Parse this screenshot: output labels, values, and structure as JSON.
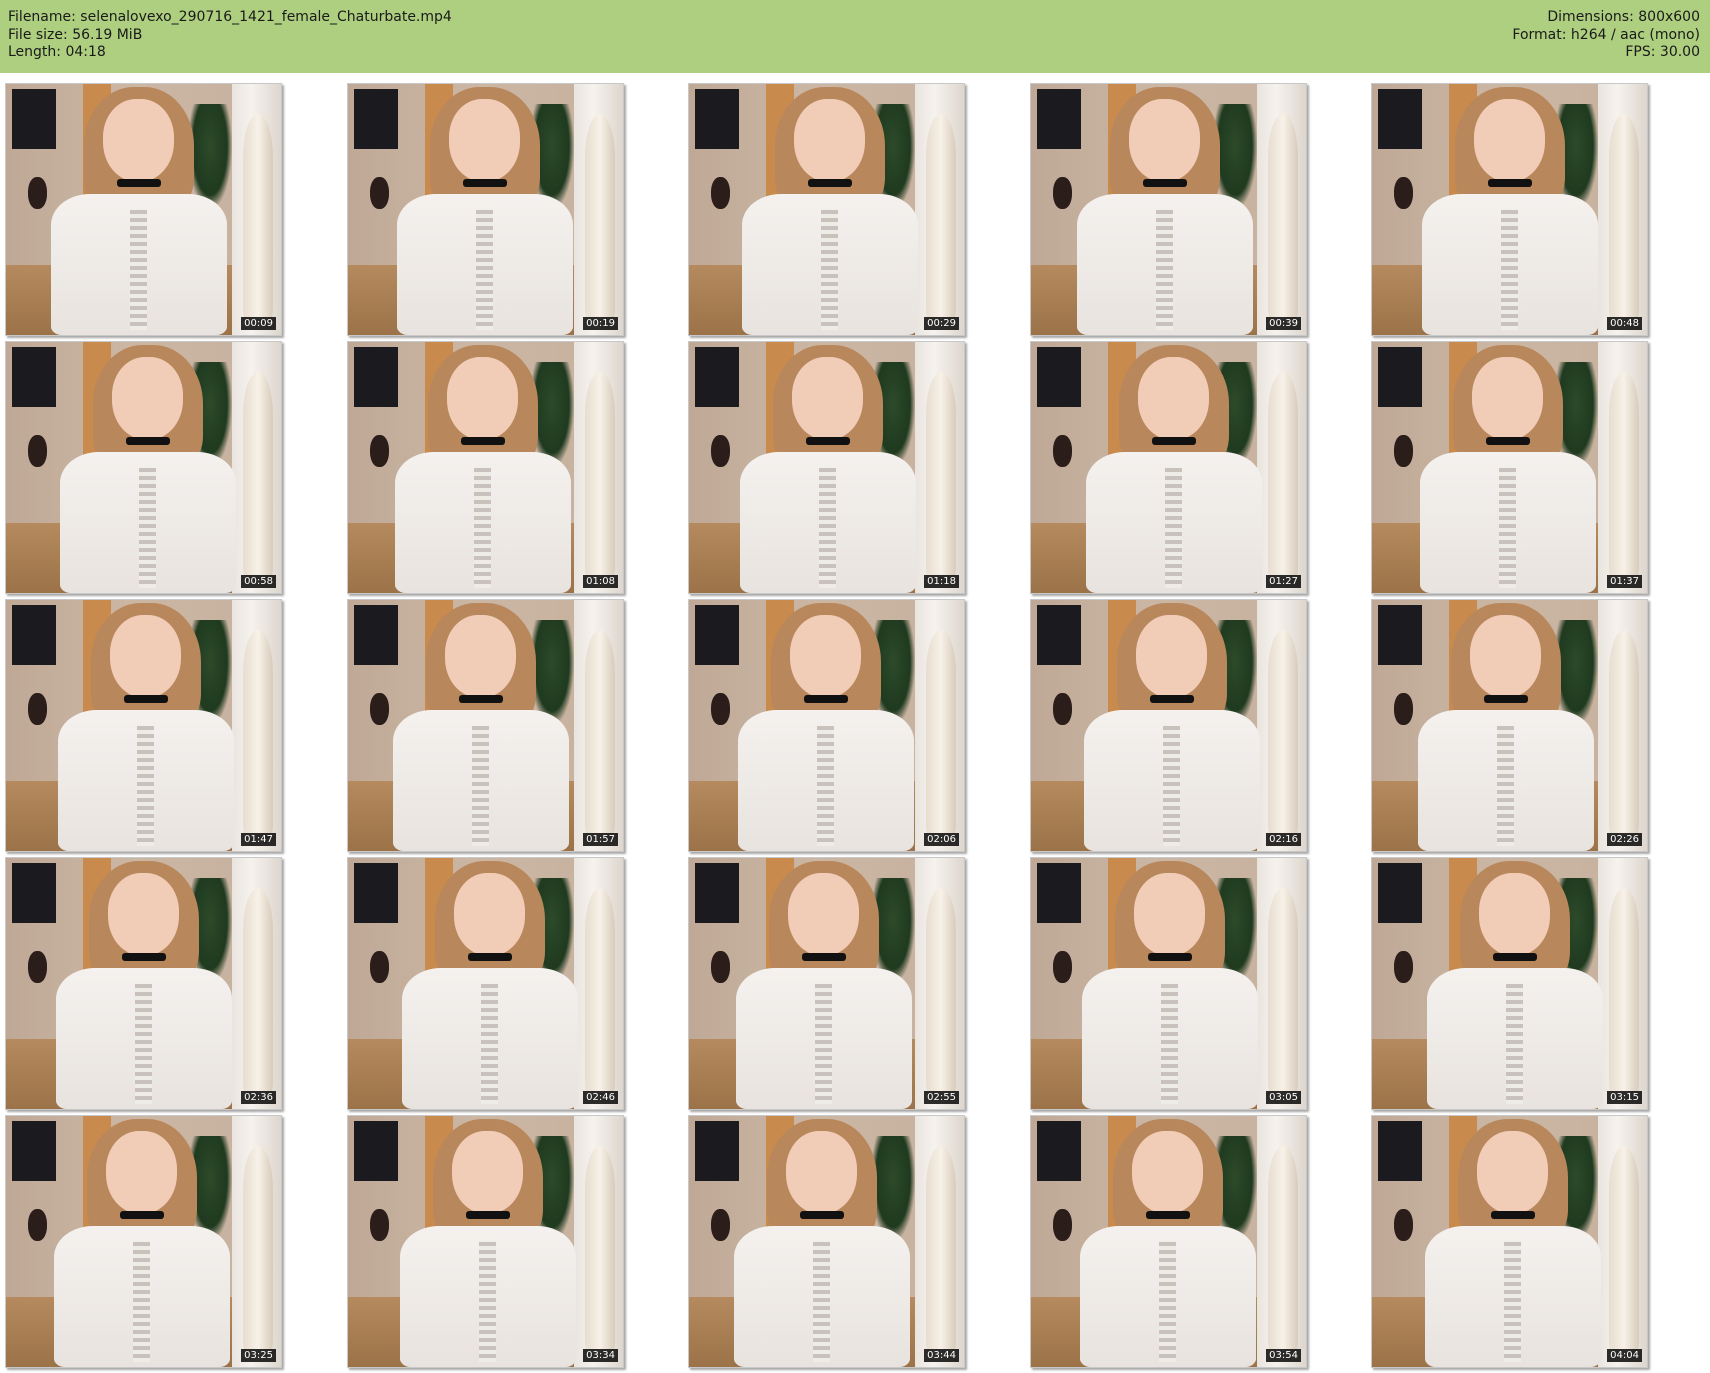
{
  "header": {
    "filename_label": "Filename: selenalovexo_290716_1421_female_Chaturbate.mp4",
    "filesize_label": "File size: 56.19 MiB",
    "length_label": "Length: 04:18",
    "dimensions_label": "Dimensions: 800x600",
    "format_label": "Format: h264 / aac (mono)",
    "fps_label": "FPS: 30.00",
    "background_color": "#aecf7f"
  },
  "thumbnails": [
    {
      "timestamp": "00:09"
    },
    {
      "timestamp": "00:19"
    },
    {
      "timestamp": "00:29"
    },
    {
      "timestamp": "00:39"
    },
    {
      "timestamp": "00:48"
    },
    {
      "timestamp": "00:58"
    },
    {
      "timestamp": "01:08"
    },
    {
      "timestamp": "01:18"
    },
    {
      "timestamp": "01:27"
    },
    {
      "timestamp": "01:37"
    },
    {
      "timestamp": "01:47"
    },
    {
      "timestamp": "01:57"
    },
    {
      "timestamp": "02:06"
    },
    {
      "timestamp": "02:16"
    },
    {
      "timestamp": "02:26"
    },
    {
      "timestamp": "02:36"
    },
    {
      "timestamp": "02:46"
    },
    {
      "timestamp": "02:55"
    },
    {
      "timestamp": "03:05"
    },
    {
      "timestamp": "03:15"
    },
    {
      "timestamp": "03:25"
    },
    {
      "timestamp": "03:34"
    },
    {
      "timestamp": "03:44"
    },
    {
      "timestamp": "03:54"
    },
    {
      "timestamp": "04:04"
    }
  ]
}
